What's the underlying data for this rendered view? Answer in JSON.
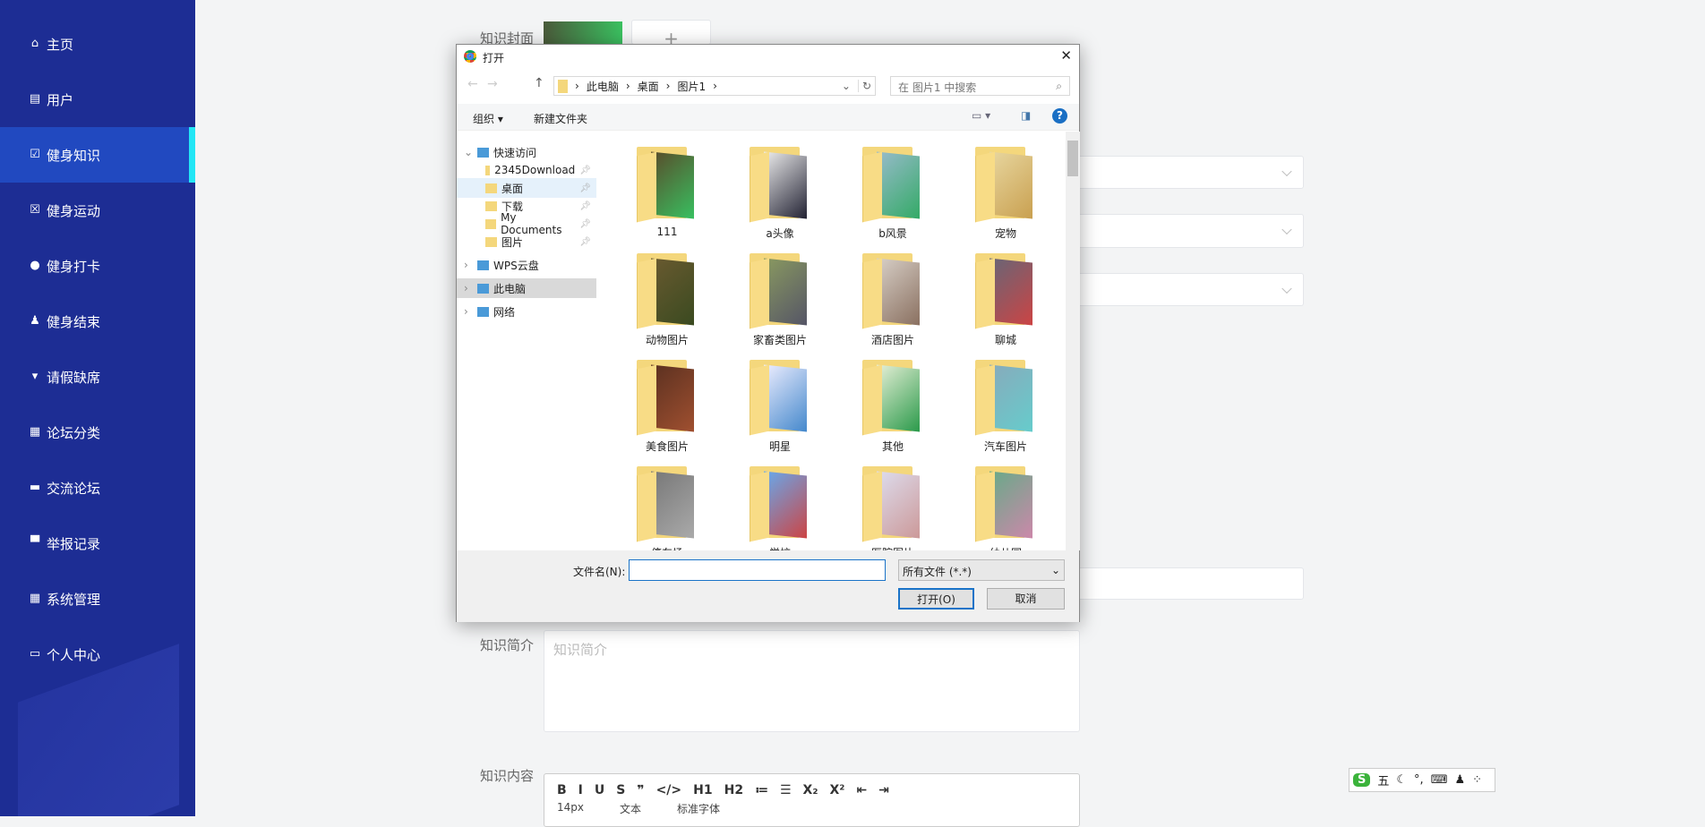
{
  "sidebar": {
    "items": [
      {
        "label": "主页",
        "icon": "home-icon",
        "glyph": "⌂"
      },
      {
        "label": "用户",
        "icon": "clipboard-icon",
        "glyph": "▤"
      },
      {
        "label": "健身知识",
        "icon": "clipboard-check-icon",
        "glyph": "☑",
        "active": true
      },
      {
        "label": "健身运动",
        "icon": "clipboard-x-icon",
        "glyph": "☒"
      },
      {
        "label": "健身打卡",
        "icon": "bulb-icon",
        "glyph": "●"
      },
      {
        "label": "健身结束",
        "icon": "user-icon",
        "glyph": "♟"
      },
      {
        "label": "请假缺席",
        "icon": "pin-icon",
        "glyph": "▾"
      },
      {
        "label": "论坛分类",
        "icon": "grid-icon",
        "glyph": "▦"
      },
      {
        "label": "交流论坛",
        "icon": "ticket-icon",
        "glyph": "▬"
      },
      {
        "label": "举报记录",
        "icon": "monitor-icon",
        "glyph": "▀"
      },
      {
        "label": "系统管理",
        "icon": "grid-icon",
        "glyph": "▦"
      },
      {
        "label": "个人中心",
        "icon": "card-icon",
        "glyph": "▭"
      }
    ]
  },
  "form": {
    "cover_label": "知识封面",
    "intro_label": "知识简介",
    "intro_placeholder": "知识简介",
    "content_label": "知识内容",
    "upload_plus": "+",
    "editor_row1": [
      "B",
      "I",
      "U",
      "S",
      "❞",
      "</>",
      "H1",
      "H2",
      "≔",
      "☰",
      "X₂",
      "X²",
      "⇤",
      "⇥"
    ],
    "editor_row2": {
      "size": "14px",
      "type": "文本",
      "font": "标准字体"
    }
  },
  "dialog": {
    "title": "打开",
    "close": "✕",
    "breadcrumb": [
      "此电脑",
      "桌面",
      "图片1"
    ],
    "search_placeholder": "在 图片1 中搜索",
    "organize": "组织 ▾",
    "new_folder": "新建文件夹",
    "nav": [
      {
        "label": "快速访问",
        "level": 0,
        "expand": "⌄"
      },
      {
        "label": "2345Download",
        "level": 1,
        "pin": true
      },
      {
        "label": "桌面",
        "level": 1,
        "pin": true,
        "hover": true
      },
      {
        "label": "下载",
        "level": 1,
        "pin": true
      },
      {
        "label": "My Documents",
        "level": 1,
        "pin": true
      },
      {
        "label": "图片",
        "level": 1,
        "pin": true
      },
      {
        "label": "WPS云盘",
        "level": 0,
        "expand": "›"
      },
      {
        "label": "此电脑",
        "level": 0,
        "expand": "›",
        "selected": true
      },
      {
        "label": "网络",
        "level": 0,
        "expand": "›"
      }
    ],
    "folders": [
      {
        "name": "111",
        "colors": [
          "#5a4a2a",
          "#38c060"
        ]
      },
      {
        "name": "a头像",
        "colors": [
          "#eee",
          "#223"
        ]
      },
      {
        "name": "b风景",
        "colors": [
          "#9bc",
          "#3a6"
        ]
      },
      {
        "name": "宠物",
        "colors": [
          "#e8d7a0",
          "#c9a050"
        ]
      },
      {
        "name": "动物图片",
        "colors": [
          "#6a5a30",
          "#3a4a20"
        ]
      },
      {
        "name": "家畜类图片",
        "colors": [
          "#8a9a60",
          "#556"
        ]
      },
      {
        "name": "酒店图片",
        "colors": [
          "#d8d0c8",
          "#8a7060"
        ]
      },
      {
        "name": "聊城",
        "colors": [
          "#667",
          "#c44"
        ]
      },
      {
        "name": "美食图片",
        "colors": [
          "#5a3020",
          "#a05030"
        ]
      },
      {
        "name": "明星",
        "colors": [
          "#eef",
          "#48c"
        ]
      },
      {
        "name": "其他",
        "colors": [
          "#e8f0d8",
          "#2a9a4a"
        ]
      },
      {
        "name": "汽车图片",
        "colors": [
          "#8ab",
          "#6cc"
        ]
      },
      {
        "name": "停车场",
        "colors": [
          "#777",
          "#aaa"
        ]
      },
      {
        "name": "学校",
        "colors": [
          "#6ae",
          "#c44"
        ]
      },
      {
        "name": "医院图片",
        "colors": [
          "#dde",
          "#c99"
        ]
      },
      {
        "name": "幼儿园",
        "colors": [
          "#6a8",
          "#c8a"
        ]
      }
    ],
    "filename_label": "文件名(N):",
    "filename_value": "",
    "filetype": "所有文件 (*.*)",
    "open": "打开(O)",
    "cancel": "取消"
  },
  "ime": {
    "logo": "S",
    "items": [
      "五",
      "☾",
      "°,",
      "⌨",
      "♟",
      "⁘"
    ]
  }
}
